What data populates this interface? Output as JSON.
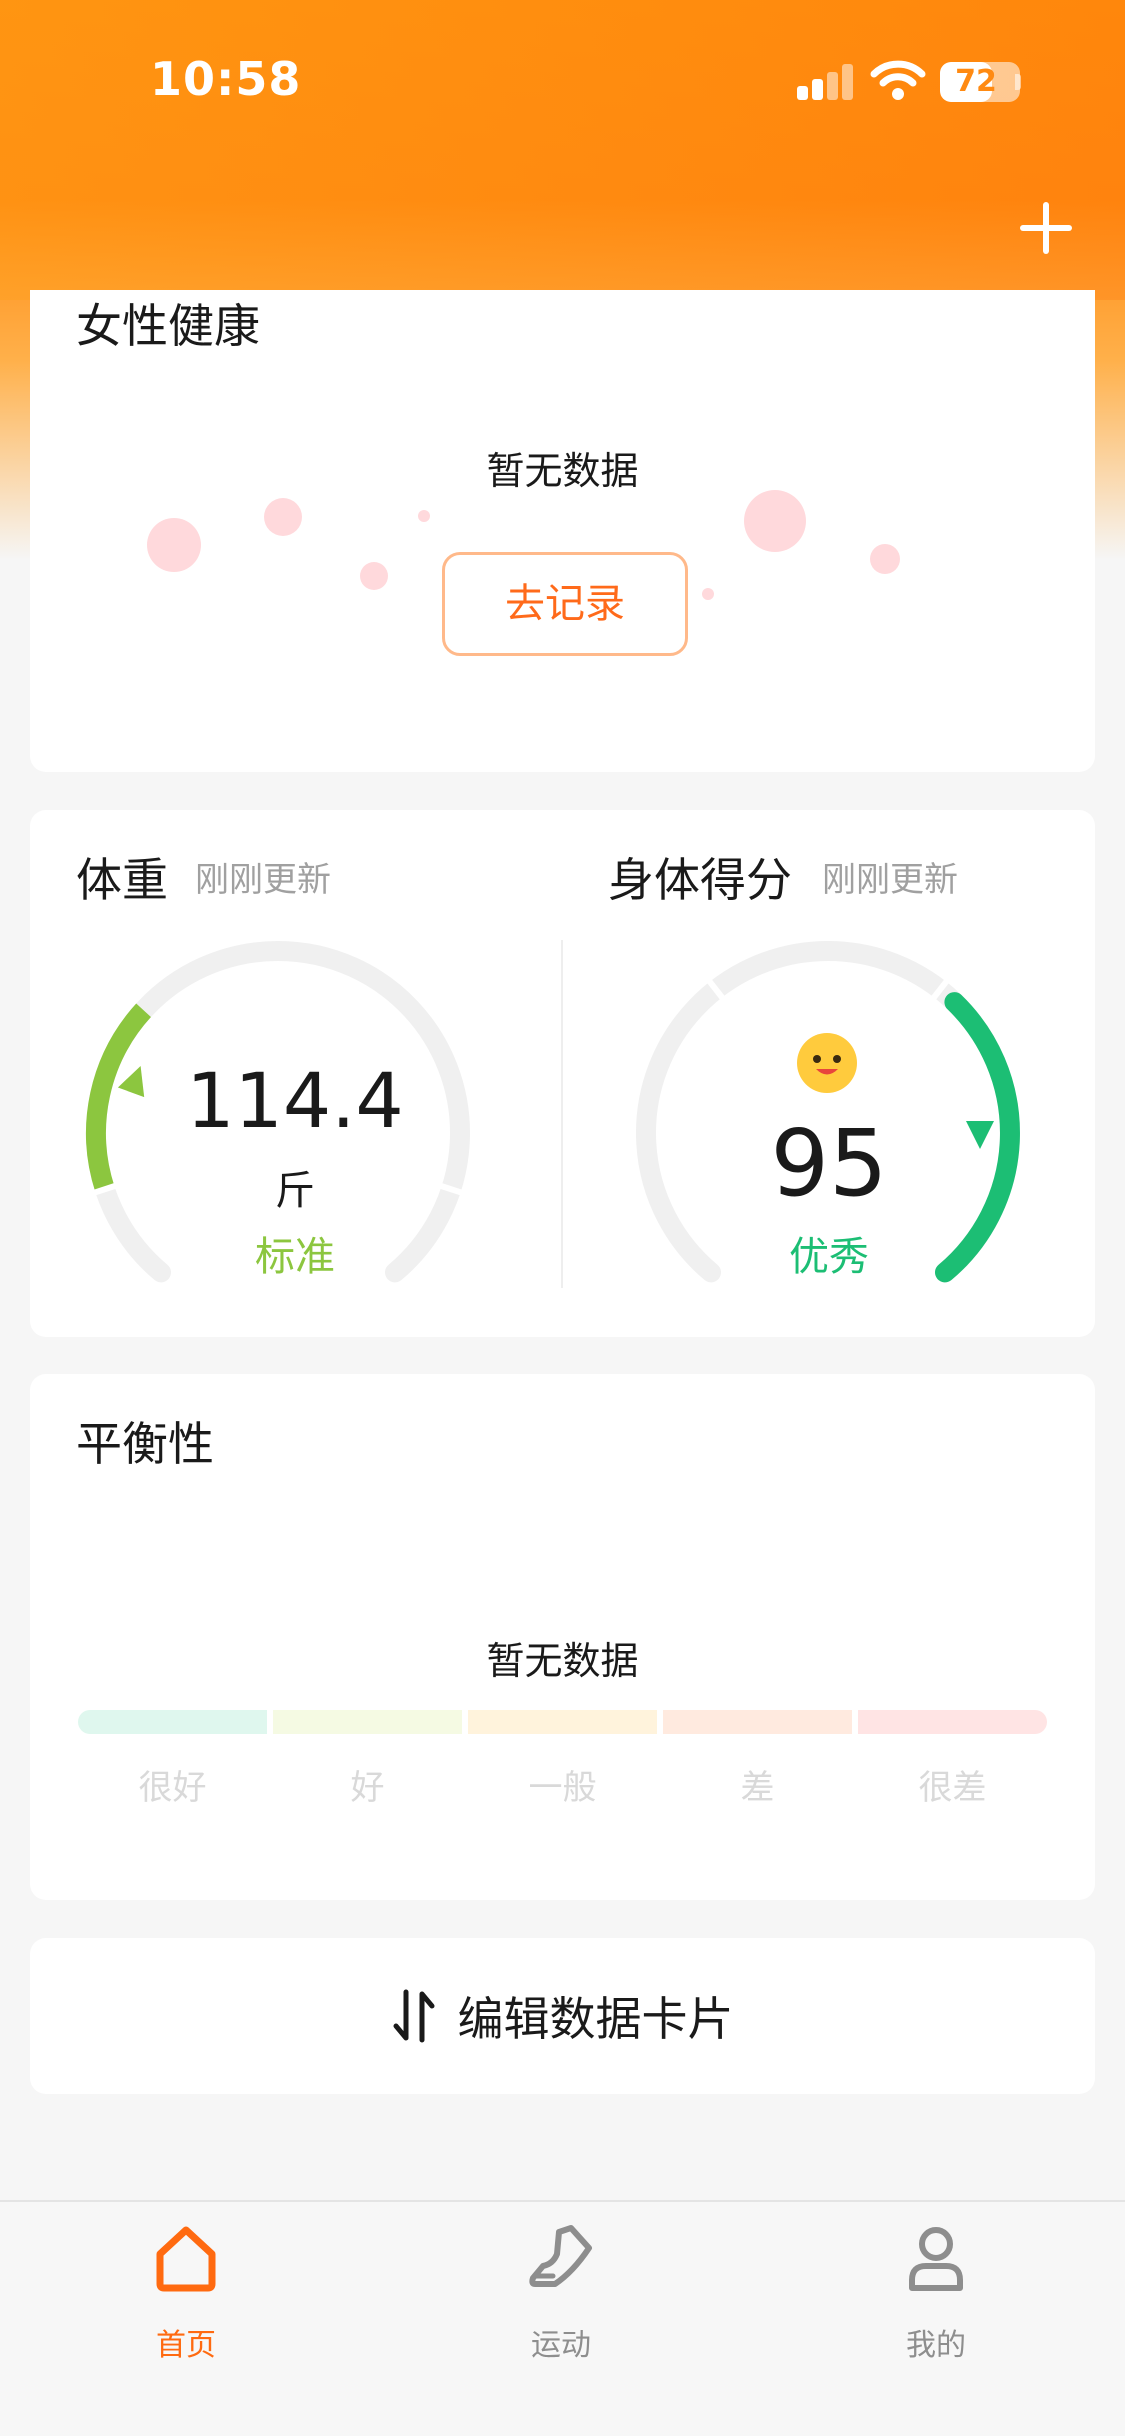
{
  "status_bar": {
    "time": "10:58",
    "battery": "72",
    "battery_level": 0.72
  },
  "header": {
    "add_icon": "plus-icon"
  },
  "women_health": {
    "title": "女性健康",
    "empty_text": "暂无数据",
    "record_button": "去记录"
  },
  "weight": {
    "title": "体重",
    "updated": "刚刚更新",
    "value": "114.4",
    "unit": "斤",
    "status": "标准",
    "gauge_fraction": 0.33,
    "color": "#8cc63f"
  },
  "body_score": {
    "title": "身体得分",
    "updated": "刚刚更新",
    "value": "95",
    "status": "优秀",
    "gauge_fraction": 0.95,
    "color": "#1cbe74",
    "emoji_icon": "smiley-face-icon"
  },
  "balance": {
    "title": "平衡性",
    "empty_text": "暂无数据",
    "scale": [
      {
        "label": "很好",
        "color": "#dff7ee"
      },
      {
        "label": "好",
        "color": "#f5fae3"
      },
      {
        "label": "一般",
        "color": "#fff3dc"
      },
      {
        "label": "差",
        "color": "#ffeadf"
      },
      {
        "label": "很差",
        "color": "#ffe4e4"
      }
    ]
  },
  "edit_card": {
    "label": "编辑数据卡片",
    "icon": "sort-arrows-icon"
  },
  "tabbar": {
    "items": [
      {
        "label": "首页",
        "icon": "home-icon",
        "active": true
      },
      {
        "label": "运动",
        "icon": "sneaker-icon",
        "active": false
      },
      {
        "label": "我的",
        "icon": "user-icon",
        "active": false
      }
    ]
  },
  "colors": {
    "brand": "#ff8a12",
    "accent": "#ff6a10"
  }
}
